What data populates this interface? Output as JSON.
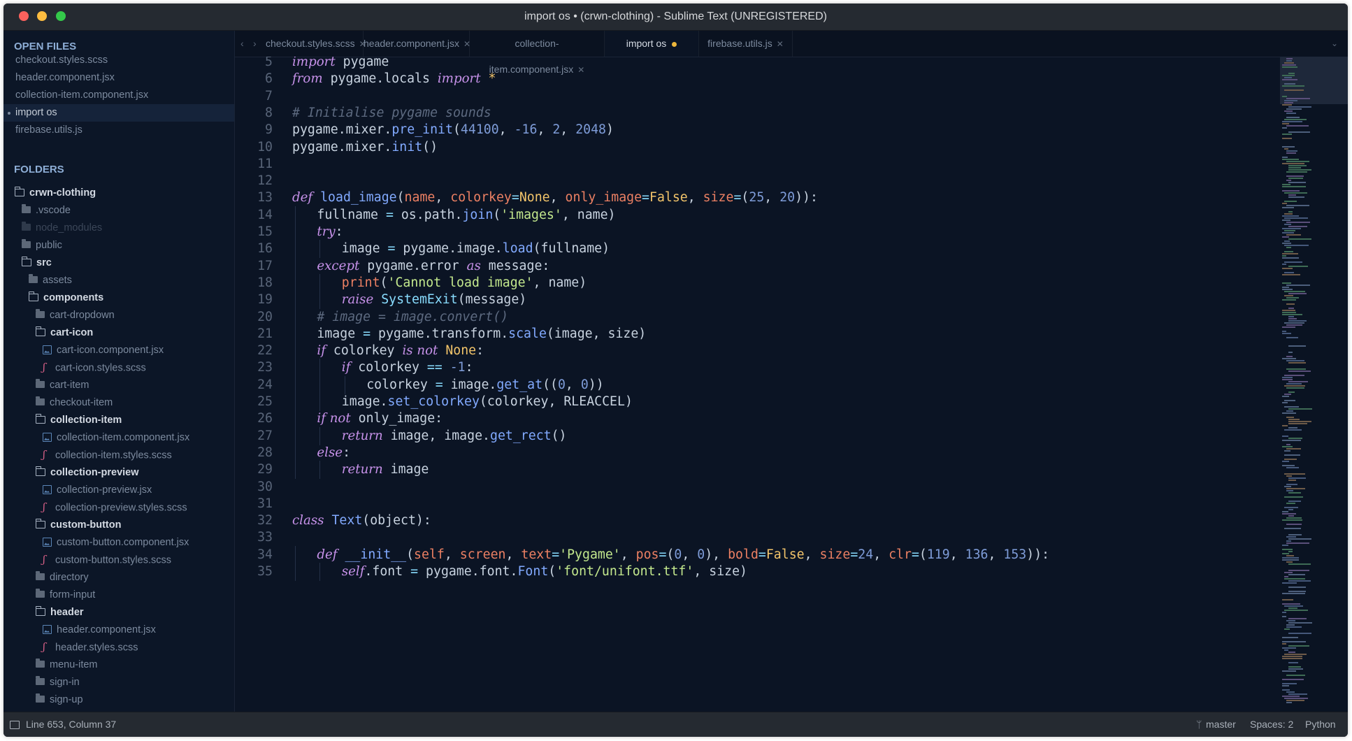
{
  "window": {
    "title": "import os • (crwn-clothing) - Sublime Text (UNREGISTERED)"
  },
  "colors": {
    "close": "#fc615d",
    "minimize": "#fdbc40",
    "maximize": "#34c84a",
    "accent": "#ecb63b",
    "background": "#0b1424"
  },
  "sidebar": {
    "open_files_title": "OPEN FILES",
    "open_files": [
      "checkout.styles.scss",
      "header.component.jsx",
      "collection-item.component.jsx",
      "import os",
      "firebase.utils.js"
    ],
    "folders_title": "FOLDERS",
    "tree": [
      {
        "label": "crwn-clothing",
        "icon": "folder-open-icon",
        "state": "open"
      },
      {
        "label": ".vscode",
        "icon": "folder-icon",
        "state": "closed"
      },
      {
        "label": "node_modules",
        "icon": "folder-icon",
        "state": "ignored"
      },
      {
        "label": "public",
        "icon": "folder-icon",
        "state": "closed"
      },
      {
        "label": "src",
        "icon": "folder-open-icon",
        "state": "open"
      },
      {
        "label": "assets",
        "icon": "folder-icon",
        "state": "closed"
      },
      {
        "label": "components",
        "icon": "folder-open-icon",
        "state": "open"
      },
      {
        "label": "cart-dropdown",
        "icon": "folder-icon",
        "state": "closed"
      },
      {
        "label": "cart-icon",
        "icon": "folder-open-icon",
        "state": "open"
      },
      {
        "label": "cart-icon.component.jsx",
        "icon": "jsx-file-icon",
        "state": "file"
      },
      {
        "label": "cart-icon.styles.scss",
        "icon": "scss-file-icon",
        "state": "file"
      },
      {
        "label": "cart-item",
        "icon": "folder-icon",
        "state": "closed"
      },
      {
        "label": "checkout-item",
        "icon": "folder-icon",
        "state": "closed"
      },
      {
        "label": "collection-item",
        "icon": "folder-open-icon",
        "state": "open"
      },
      {
        "label": "collection-item.component.jsx",
        "icon": "jsx-file-icon",
        "state": "file"
      },
      {
        "label": "collection-item.styles.scss",
        "icon": "scss-file-icon",
        "state": "file"
      },
      {
        "label": "collection-preview",
        "icon": "folder-open-icon",
        "state": "open"
      },
      {
        "label": "collection-preview.jsx",
        "icon": "jsx-file-icon",
        "state": "file"
      },
      {
        "label": "collection-preview.styles.scss",
        "icon": "scss-file-icon",
        "state": "file"
      },
      {
        "label": "custom-button",
        "icon": "folder-open-icon",
        "state": "open"
      },
      {
        "label": "custom-button.component.jsx",
        "icon": "jsx-file-icon",
        "state": "file"
      },
      {
        "label": "custom-button.styles.scss",
        "icon": "scss-file-icon",
        "state": "file"
      },
      {
        "label": "directory",
        "icon": "folder-icon",
        "state": "closed"
      },
      {
        "label": "form-input",
        "icon": "folder-icon",
        "state": "closed"
      },
      {
        "label": "header",
        "icon": "folder-open-icon",
        "state": "open"
      },
      {
        "label": "header.component.jsx",
        "icon": "jsx-file-icon",
        "state": "file"
      },
      {
        "label": "header.styles.scss",
        "icon": "scss-file-icon",
        "state": "file"
      },
      {
        "label": "menu-item",
        "icon": "folder-icon",
        "state": "closed"
      },
      {
        "label": "sign-in",
        "icon": "folder-icon",
        "state": "closed"
      },
      {
        "label": "sign-up",
        "icon": "folder-icon",
        "state": "closed"
      }
    ]
  },
  "tabs": [
    {
      "label": "checkout.styles.scss",
      "active": false,
      "modified": false
    },
    {
      "label": "header.component.jsx",
      "active": false,
      "modified": false
    },
    {
      "label": "collection-item.component.jsx",
      "active": false,
      "modified": false
    },
    {
      "label": "import os",
      "active": true,
      "modified": true
    },
    {
      "label": "firebase.utils.js",
      "active": false,
      "modified": false
    }
  ],
  "editor": {
    "lines": [
      {
        "n": "5",
        "indent": 0,
        "t": [
          [
            "kw",
            "import"
          ],
          [
            "p",
            " pygame"
          ]
        ]
      },
      {
        "n": "6",
        "indent": 0,
        "t": [
          [
            "kw",
            "from"
          ],
          [
            "p",
            " pygame.locals "
          ],
          [
            "kw",
            "import"
          ],
          [
            "const",
            " *"
          ]
        ]
      },
      {
        "n": "7",
        "indent": 0,
        "t": []
      },
      {
        "n": "8",
        "indent": 0,
        "t": [
          [
            "cm",
            "# Initialise pygame sounds"
          ]
        ]
      },
      {
        "n": "9",
        "indent": 0,
        "t": [
          [
            "p",
            "pygame.mixer."
          ],
          [
            "fn",
            "pre_init"
          ],
          [
            "p",
            "("
          ],
          [
            "num",
            "44100"
          ],
          [
            "p",
            ", "
          ],
          [
            "num",
            "-16"
          ],
          [
            "p",
            ", "
          ],
          [
            "num",
            "2"
          ],
          [
            "p",
            ", "
          ],
          [
            "num",
            "2048"
          ],
          [
            "p",
            ")"
          ]
        ]
      },
      {
        "n": "10",
        "indent": 0,
        "t": [
          [
            "p",
            "pygame.mixer."
          ],
          [
            "fn",
            "init"
          ],
          [
            "p",
            "()"
          ]
        ]
      },
      {
        "n": "11",
        "indent": 0,
        "t": []
      },
      {
        "n": "12",
        "indent": 0,
        "t": []
      },
      {
        "n": "13",
        "indent": 0,
        "t": [
          [
            "kw",
            "def"
          ],
          [
            "p",
            " "
          ],
          [
            "fn",
            "load_image"
          ],
          [
            "p",
            "("
          ],
          [
            "param",
            "name"
          ],
          [
            "p",
            ", "
          ],
          [
            "param",
            "colorkey"
          ],
          [
            "op",
            "="
          ],
          [
            "const",
            "None"
          ],
          [
            "p",
            ", "
          ],
          [
            "param",
            "only_image"
          ],
          [
            "op",
            "="
          ],
          [
            "const",
            "False"
          ],
          [
            "p",
            ", "
          ],
          [
            "param",
            "size"
          ],
          [
            "op",
            "="
          ],
          [
            "p",
            "("
          ],
          [
            "num",
            "25"
          ],
          [
            "p",
            ", "
          ],
          [
            "num",
            "20"
          ],
          [
            "p",
            "))"
          ],
          [
            "p",
            ":"
          ]
        ]
      },
      {
        "n": "14",
        "indent": 1,
        "t": [
          [
            "p",
            "fullname "
          ],
          [
            "op",
            "="
          ],
          [
            "p",
            " os.path."
          ],
          [
            "fn",
            "join"
          ],
          [
            "p",
            "("
          ],
          [
            "str",
            "'images'"
          ],
          [
            "p",
            ", name)"
          ]
        ]
      },
      {
        "n": "15",
        "indent": 1,
        "t": [
          [
            "kw",
            "try"
          ],
          [
            "p",
            ":"
          ]
        ]
      },
      {
        "n": "16",
        "indent": 2,
        "t": [
          [
            "p",
            "image "
          ],
          [
            "op",
            "="
          ],
          [
            "p",
            " pygame.image."
          ],
          [
            "fn",
            "load"
          ],
          [
            "p",
            "(fullname)"
          ]
        ]
      },
      {
        "n": "17",
        "indent": 1,
        "t": [
          [
            "kw",
            "except"
          ],
          [
            "p",
            " pygame.error "
          ],
          [
            "kw",
            "as"
          ],
          [
            "p",
            " message:"
          ]
        ]
      },
      {
        "n": "18",
        "indent": 2,
        "t": [
          [
            "mth",
            "print"
          ],
          [
            "p",
            "("
          ],
          [
            "str",
            "'Cannot load image'"
          ],
          [
            "p",
            ", name)"
          ]
        ]
      },
      {
        "n": "19",
        "indent": 2,
        "t": [
          [
            "kw",
            "raise"
          ],
          [
            "p",
            " "
          ],
          [
            "cls",
            "SystemExit"
          ],
          [
            "p",
            "(message)"
          ]
        ]
      },
      {
        "n": "20",
        "indent": 1,
        "t": [
          [
            "cm",
            "# image = image.convert()"
          ]
        ]
      },
      {
        "n": "21",
        "indent": 1,
        "t": [
          [
            "p",
            "image "
          ],
          [
            "op",
            "="
          ],
          [
            "p",
            " pygame.transform."
          ],
          [
            "fn",
            "scale"
          ],
          [
            "p",
            "(image, size)"
          ]
        ]
      },
      {
        "n": "22",
        "indent": 1,
        "t": [
          [
            "kw",
            "if"
          ],
          [
            "p",
            " colorkey "
          ],
          [
            "kw",
            "is not"
          ],
          [
            "p",
            " "
          ],
          [
            "const",
            "None"
          ],
          [
            "p",
            ":"
          ]
        ]
      },
      {
        "n": "23",
        "indent": 2,
        "t": [
          [
            "kw",
            "if"
          ],
          [
            "p",
            " colorkey "
          ],
          [
            "op",
            "=="
          ],
          [
            "p",
            " "
          ],
          [
            "num",
            "-1"
          ],
          [
            "p",
            ":"
          ]
        ]
      },
      {
        "n": "24",
        "indent": 3,
        "t": [
          [
            "p",
            "colorkey "
          ],
          [
            "op",
            "="
          ],
          [
            "p",
            " image."
          ],
          [
            "fn",
            "get_at"
          ],
          [
            "p",
            "(("
          ],
          [
            "num",
            "0"
          ],
          [
            "p",
            ", "
          ],
          [
            "num",
            "0"
          ],
          [
            "p",
            "))"
          ]
        ]
      },
      {
        "n": "25",
        "indent": 2,
        "t": [
          [
            "p",
            "image."
          ],
          [
            "fn",
            "set_colorkey"
          ],
          [
            "p",
            "(colorkey, RLEACCEL)"
          ]
        ]
      },
      {
        "n": "26",
        "indent": 1,
        "t": [
          [
            "kw",
            "if not"
          ],
          [
            "p",
            " only_image:"
          ]
        ]
      },
      {
        "n": "27",
        "indent": 2,
        "t": [
          [
            "kw",
            "return"
          ],
          [
            "p",
            " image, image."
          ],
          [
            "fn",
            "get_rect"
          ],
          [
            "p",
            "()"
          ]
        ]
      },
      {
        "n": "28",
        "indent": 1,
        "t": [
          [
            "kw",
            "else"
          ],
          [
            "p",
            ":"
          ]
        ]
      },
      {
        "n": "29",
        "indent": 2,
        "t": [
          [
            "kw",
            "return"
          ],
          [
            "p",
            " image"
          ]
        ]
      },
      {
        "n": "30",
        "indent": 0,
        "t": []
      },
      {
        "n": "31",
        "indent": 0,
        "t": []
      },
      {
        "n": "32",
        "indent": 0,
        "t": [
          [
            "kw",
            "class"
          ],
          [
            "p",
            " "
          ],
          [
            "fn",
            "Text"
          ],
          [
            "p",
            "(object):"
          ]
        ]
      },
      {
        "n": "33",
        "indent": 0,
        "t": []
      },
      {
        "n": "34",
        "indent": 1,
        "t": [
          [
            "kw",
            "def"
          ],
          [
            "p",
            " "
          ],
          [
            "fn",
            "__init__"
          ],
          [
            "p",
            "("
          ],
          [
            "param",
            "self"
          ],
          [
            "p",
            ", "
          ],
          [
            "param",
            "screen"
          ],
          [
            "p",
            ", "
          ],
          [
            "param",
            "text"
          ],
          [
            "op",
            "="
          ],
          [
            "str",
            "'Pygame'"
          ],
          [
            "p",
            ", "
          ],
          [
            "param",
            "pos"
          ],
          [
            "op",
            "="
          ],
          [
            "p",
            "("
          ],
          [
            "num",
            "0"
          ],
          [
            "p",
            ", "
          ],
          [
            "num",
            "0"
          ],
          [
            "p",
            "), "
          ],
          [
            "param",
            "bold"
          ],
          [
            "op",
            "="
          ],
          [
            "const",
            "False"
          ],
          [
            "p",
            ", "
          ],
          [
            "param",
            "size"
          ],
          [
            "op",
            "="
          ],
          [
            "num",
            "24"
          ],
          [
            "p",
            ", "
          ],
          [
            "param",
            "clr"
          ],
          [
            "op",
            "="
          ],
          [
            "p",
            "("
          ],
          [
            "num",
            "119"
          ],
          [
            "p",
            ", "
          ],
          [
            "num",
            "136"
          ],
          [
            "p",
            ", "
          ],
          [
            "num",
            "153"
          ],
          [
            "p",
            "))"
          ],
          [
            "p",
            ":"
          ]
        ]
      },
      {
        "n": "35",
        "indent": 2,
        "t": [
          [
            "kw",
            "self"
          ],
          [
            "p",
            ".font "
          ],
          [
            "op",
            "="
          ],
          [
            "p",
            " pygame.font."
          ],
          [
            "fn",
            "Font"
          ],
          [
            "p",
            "("
          ],
          [
            "str",
            "'font/unifont.ttf'"
          ],
          [
            "p",
            ", size)"
          ]
        ]
      }
    ]
  },
  "status": {
    "position": "Line 653, Column 37",
    "branch": "master",
    "spaces": "Spaces: 2",
    "syntax": "Python"
  }
}
